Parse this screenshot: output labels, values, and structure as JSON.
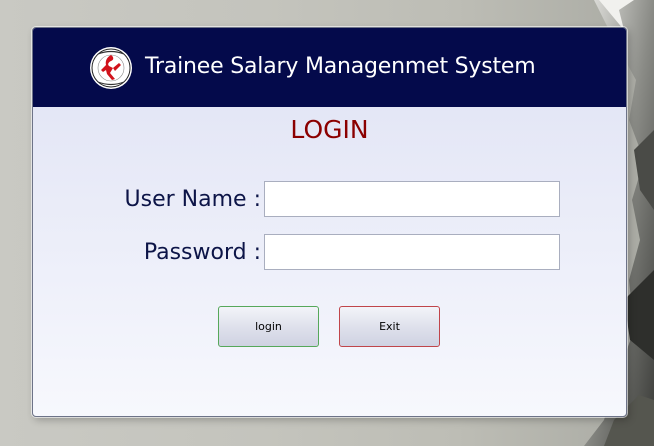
{
  "window": {
    "title": "Trainee Salary Managenmet System",
    "logo_icon": "university-crest-icon"
  },
  "login": {
    "heading": "LOGIN",
    "username_label": "User Name :",
    "username_value": "",
    "password_label": "Password :",
    "password_value": "",
    "login_button": "login",
    "exit_button": "Exit"
  },
  "colors": {
    "header_bg": "#040a4b",
    "heading": "#8b0000",
    "label": "#0c1447",
    "login_border": "#56a85a",
    "exit_border": "#c0454a"
  }
}
